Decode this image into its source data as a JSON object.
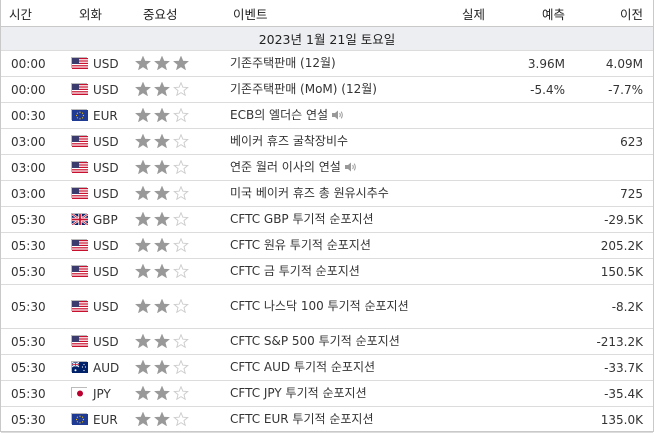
{
  "header": {
    "time": "시간",
    "currency": "외화",
    "importance": "중요성",
    "event": "이벤트",
    "actual": "실제",
    "forecast": "예측",
    "previous": "이전"
  },
  "date_label": "2023년 1월 21일 토요일",
  "colors": {
    "star_filled": "#999999",
    "star_empty": "#cccccc",
    "date_bg": "#edeef2"
  },
  "rows": [
    {
      "time": "00:00",
      "flag": "us-flag-icon",
      "currency": "USD",
      "importance": 3,
      "event": "기존주택판매 (12월)",
      "speaker": false,
      "actual": "",
      "forecast": "3.96M",
      "previous": "4.09M"
    },
    {
      "time": "00:00",
      "flag": "us-flag-icon",
      "currency": "USD",
      "importance": 2,
      "event": "기존주택판매 (MoM) (12월)",
      "speaker": false,
      "actual": "",
      "forecast": "-5.4%",
      "previous": "-7.7%"
    },
    {
      "time": "00:30",
      "flag": "eu-flag-icon",
      "currency": "EUR",
      "importance": 2,
      "event": "ECB의 엘더슨 연설",
      "speaker": true,
      "actual": "",
      "forecast": "",
      "previous": ""
    },
    {
      "time": "03:00",
      "flag": "us-flag-icon",
      "currency": "USD",
      "importance": 2,
      "event": "베이커 휴즈 굴착장비수",
      "speaker": false,
      "actual": "",
      "forecast": "",
      "previous": "623"
    },
    {
      "time": "03:00",
      "flag": "us-flag-icon",
      "currency": "USD",
      "importance": 2,
      "event": "연준 월러 이사의 연설",
      "speaker": true,
      "actual": "",
      "forecast": "",
      "previous": ""
    },
    {
      "time": "03:00",
      "flag": "us-flag-icon",
      "currency": "USD",
      "importance": 2,
      "event": "미국 베이커 휴즈 총 원유시추수",
      "speaker": false,
      "actual": "",
      "forecast": "",
      "previous": "725"
    },
    {
      "time": "05:30",
      "flag": "uk-flag-icon",
      "currency": "GBP",
      "importance": 2,
      "event": "CFTC GBP 투기적 순포지션",
      "speaker": false,
      "actual": "",
      "forecast": "",
      "previous": "-29.5K"
    },
    {
      "time": "05:30",
      "flag": "us-flag-icon",
      "currency": "USD",
      "importance": 2,
      "event": "CFTC 원유 투기적 순포지션",
      "speaker": false,
      "actual": "",
      "forecast": "",
      "previous": "205.2K"
    },
    {
      "time": "05:30",
      "flag": "us-flag-icon",
      "currency": "USD",
      "importance": 2,
      "event": "CFTC 금 투기적 순포지션",
      "speaker": false,
      "actual": "",
      "forecast": "",
      "previous": "150.5K"
    },
    {
      "time": "05:30",
      "flag": "us-flag-icon",
      "currency": "USD",
      "importance": 2,
      "event": "CFTC 나스닥 100 투기적 순포지션",
      "speaker": false,
      "actual": "",
      "forecast": "",
      "previous": "-8.2K",
      "tall": true
    },
    {
      "time": "05:30",
      "flag": "us-flag-icon",
      "currency": "USD",
      "importance": 2,
      "event": "CFTC S&P 500 투기적 순포지션",
      "speaker": false,
      "actual": "",
      "forecast": "",
      "previous": "-213.2K"
    },
    {
      "time": "05:30",
      "flag": "au-flag-icon",
      "currency": "AUD",
      "importance": 2,
      "event": "CFTC AUD 투기적 순포지션",
      "speaker": false,
      "actual": "",
      "forecast": "",
      "previous": "-33.7K"
    },
    {
      "time": "05:30",
      "flag": "jp-flag-icon",
      "currency": "JPY",
      "importance": 2,
      "event": "CFTC JPY 투기적 순포지션",
      "speaker": false,
      "actual": "",
      "forecast": "",
      "previous": "-35.4K"
    },
    {
      "time": "05:30",
      "flag": "eu-flag-icon",
      "currency": "EUR",
      "importance": 2,
      "event": "CFTC EUR 투기적 순포지션",
      "speaker": false,
      "actual": "",
      "forecast": "",
      "previous": "135.0K"
    }
  ]
}
